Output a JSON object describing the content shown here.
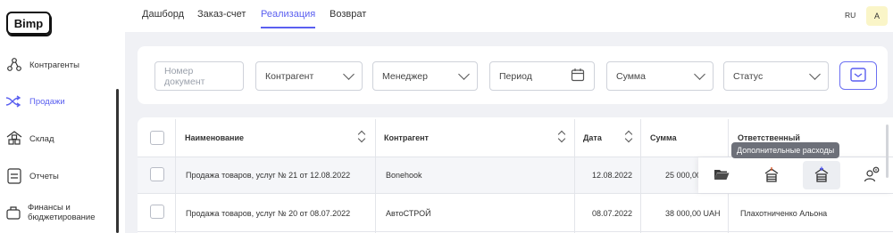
{
  "app": {
    "logo": "Bimp"
  },
  "sidebar": {
    "items": [
      {
        "label": "Контрагенты",
        "icon": "contacts-icon"
      },
      {
        "label": "Продажи",
        "icon": "sales-icon",
        "active": true
      },
      {
        "label": "Склад",
        "icon": "warehouse-icon"
      },
      {
        "label": "Отчеты",
        "icon": "reports-icon"
      },
      {
        "label": "Финансы и бюджетирование",
        "icon": "finance-icon"
      }
    ]
  },
  "topnav": {
    "tabs": [
      {
        "label": "Дашборд"
      },
      {
        "label": "Заказ-счет"
      },
      {
        "label": "Реализация",
        "active": true
      },
      {
        "label": "Возврат"
      }
    ],
    "lang": "RU",
    "avatar": "A"
  },
  "filters": {
    "doc_number_placeholder": "Номер документ",
    "counterparty": "Контрагент",
    "manager": "Менеджер",
    "period": "Период",
    "amount": "Сумма",
    "status": "Статус"
  },
  "table": {
    "headers": {
      "name": "Наименование",
      "counterparty": "Контрагент",
      "date": "Дата",
      "amount": "Сумма",
      "responsible": "Ответственный"
    },
    "rows": [
      {
        "name": "Продажа товаров, услуг № 21 от 12.08.2022",
        "counterparty": "Bonehook",
        "date": "12.08.2022",
        "amount": "25 000,00",
        "responsible": ""
      },
      {
        "name": "Продажа товаров, услуг № 20 от 08.07.2022",
        "counterparty": "АвтоСТРОЙ",
        "date": "08.07.2022",
        "amount": "38 000,00 UAH",
        "responsible": "Плахотниченко Альона"
      }
    ]
  },
  "row_actions": {
    "tooltip": "Дополнительные расходы",
    "icons": [
      "folder-open-icon",
      "warehouse-out-icon",
      "warehouse-add-icon",
      "user-count-icon"
    ]
  },
  "colors": {
    "accent": "#5a5ff0",
    "background": "#f0f1f5"
  }
}
